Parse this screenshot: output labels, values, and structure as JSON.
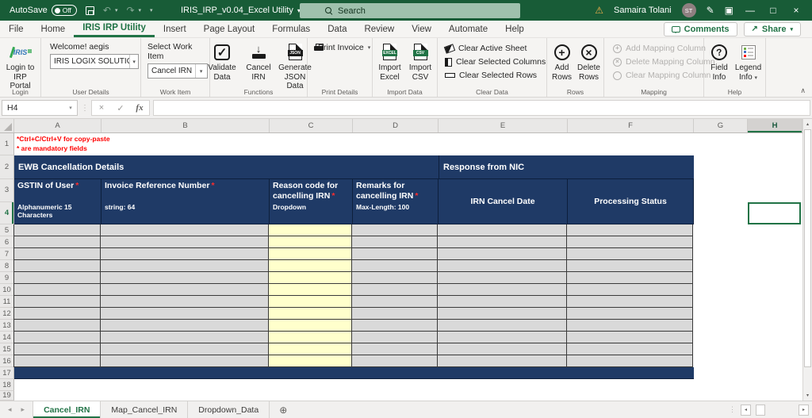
{
  "titlebar": {
    "autosave_label": "AutoSave",
    "autosave_state": "Off",
    "doc_title": "IRIS_IRP_v0.04_Excel Utility",
    "search_placeholder": "Search",
    "user_name": "Samaira Tolani",
    "user_initials": "ST"
  },
  "menu": {
    "tabs": [
      {
        "label": "File"
      },
      {
        "label": "Home"
      },
      {
        "label": "IRIS IRP Utility"
      },
      {
        "label": "Insert"
      },
      {
        "label": "Page Layout"
      },
      {
        "label": "Formulas"
      },
      {
        "label": "Data"
      },
      {
        "label": "Review"
      },
      {
        "label": "View"
      },
      {
        "label": "Automate"
      },
      {
        "label": "Help"
      }
    ],
    "comments_label": "Comments",
    "share_label": "Share"
  },
  "ribbon": {
    "login": {
      "logo_text": "IRIS",
      "button": "Login to IRP Portal",
      "group_label": "Login"
    },
    "user_details": {
      "caption": "Welcome! aegis",
      "value": "IRIS LOGIX SOLUTIONS...",
      "group_label": "User Details"
    },
    "work_item": {
      "caption": "Select Work Item",
      "value": "Cancel IRN",
      "group_label": "Work Item"
    },
    "functions": {
      "buttons": [
        {
          "label": "Validate Data"
        },
        {
          "label": "Cancel IRN"
        },
        {
          "label": "Generate JSON Data"
        }
      ],
      "json_icon_text": "JSON",
      "group_label": "Functions"
    },
    "print_details": {
      "button": "Print Invoice",
      "group_label": "Print Details"
    },
    "import_data": {
      "buttons": [
        {
          "label": "Import Excel",
          "icon_text": "EXCEL"
        },
        {
          "label": "Import CSV",
          "icon_text": "CSV"
        }
      ],
      "group_label": "Import Data"
    },
    "clear_data": {
      "items": [
        {
          "label": "Clear Active Sheet"
        },
        {
          "label": "Clear Selected Columns"
        },
        {
          "label": "Clear Selected Rows"
        }
      ],
      "group_label": "Clear Data"
    },
    "rows": {
      "buttons": [
        {
          "label": "Add Rows"
        },
        {
          "label": "Delete Rows"
        }
      ],
      "group_label": "Rows"
    },
    "mapping": {
      "items": [
        {
          "label": "Add Mapping Column"
        },
        {
          "label": "Delete Mapping Column"
        },
        {
          "label": "Clear Mapping Column"
        }
      ],
      "group_label": "Mapping"
    },
    "help": {
      "buttons": [
        {
          "label": "Field Info"
        },
        {
          "label": "Legend Info"
        }
      ],
      "group_label": "Help"
    }
  },
  "formula_bar": {
    "name_box": "H4"
  },
  "grid": {
    "column_letters": [
      "A",
      "B",
      "C",
      "D",
      "E",
      "F",
      "G",
      "H"
    ],
    "row_numbers": [
      "1",
      "2",
      "3",
      "4",
      "5",
      "6",
      "7",
      "8",
      "9",
      "10",
      "11",
      "12",
      "13",
      "14",
      "15",
      "16",
      "17",
      "18",
      "19"
    ],
    "selected_cell": "H4",
    "notes": {
      "line1": "*Ctrl+C/Ctrl+V for copy-paste",
      "line2": "* are mandatory fields"
    }
  },
  "sheet": {
    "section_left": "EWB Cancellation Details",
    "section_right": "Response from NIC",
    "headers": [
      {
        "text": "GSTIN of User",
        "required": "*",
        "spec": "Alphanumeric 15 Characters"
      },
      {
        "text": "Invoice Reference Number",
        "required": "*",
        "spec": "string: 64"
      },
      {
        "text": "Reason code for cancelling IRN",
        "required": "*",
        "spec": "Dropdown"
      },
      {
        "text": "Remarks for cancelling IRN",
        "required": "*",
        "spec": "Max-Length: 100"
      }
    ],
    "response_headers": [
      {
        "text": "IRN Cancel Date"
      },
      {
        "text": "Processing Status"
      }
    ]
  },
  "tabs_bar": {
    "sheet_tabs": [
      {
        "label": "Cancel_IRN"
      },
      {
        "label": "Map_Cancel_IRN"
      },
      {
        "label": "Dropdown_Data"
      }
    ]
  },
  "icons": {
    "undo": "↶",
    "redo": "↷",
    "quick_access": "▾",
    "title_chevron": "▾",
    "warning": "⚠",
    "pencil": "✎",
    "display_options": "▣",
    "minimize": "—",
    "restore": "□",
    "close": "×",
    "chevron_down": "▾",
    "check": "✓",
    "down_arrow": "↓",
    "cancel_x": "×",
    "fx": "fx",
    "plus": "+",
    "multiply": "×",
    "question": "?",
    "collapse": "∧",
    "grip": "⋮",
    "nav_left": "◂",
    "nav_right": "▸",
    "up": "▴",
    "down": "▾",
    "add_sheet": "⊕",
    "share": "↗"
  },
  "colors": {
    "title_green": "#185c37",
    "accent_green": "#217346",
    "navy": "#1f3a66",
    "yellow": "#ffffcc",
    "row_gray": "#d9d9d9"
  }
}
